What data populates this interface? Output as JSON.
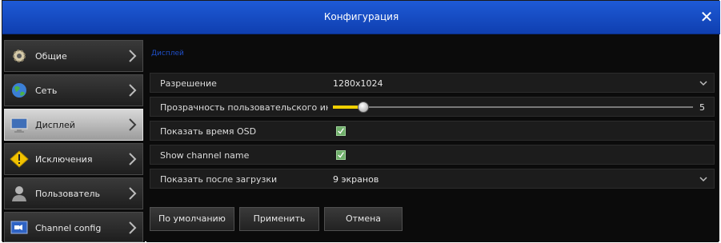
{
  "window": {
    "title": "Конфигурация"
  },
  "sidebar": {
    "items": [
      {
        "label": "Общие",
        "icon": "gear-icon"
      },
      {
        "label": "Сеть",
        "icon": "globe-icon"
      },
      {
        "label": "Дисплей",
        "icon": "monitor-icon",
        "active": true
      },
      {
        "label": "Исключения",
        "icon": "warning-icon"
      },
      {
        "label": "Пользователь",
        "icon": "user-icon"
      },
      {
        "label": "Channel config",
        "icon": "camera-screen-icon"
      }
    ]
  },
  "content": {
    "section_title": "Дисплей",
    "rows": {
      "resolution": {
        "label": "Разрешение",
        "value": "1280x1024"
      },
      "transparency": {
        "label": "Прозрачность пользовательского интерфейса",
        "value": "5",
        "min": 0,
        "max": 60
      },
      "show_osd_time": {
        "label": "Показать время OSD",
        "checked": true
      },
      "show_channel_name": {
        "label": "Show channel name",
        "checked": true
      },
      "show_after_boot": {
        "label": "Показать после загрузки",
        "value": "9 экранов"
      }
    },
    "buttons": {
      "default": "По умолчанию",
      "apply": "Применить",
      "cancel": "Отмена"
    }
  },
  "colors": {
    "titlebar": "#1e5ad6",
    "slider_fill": "#f0d000",
    "section_title": "#1f4fc9",
    "checkbox": "#6fae6a"
  }
}
